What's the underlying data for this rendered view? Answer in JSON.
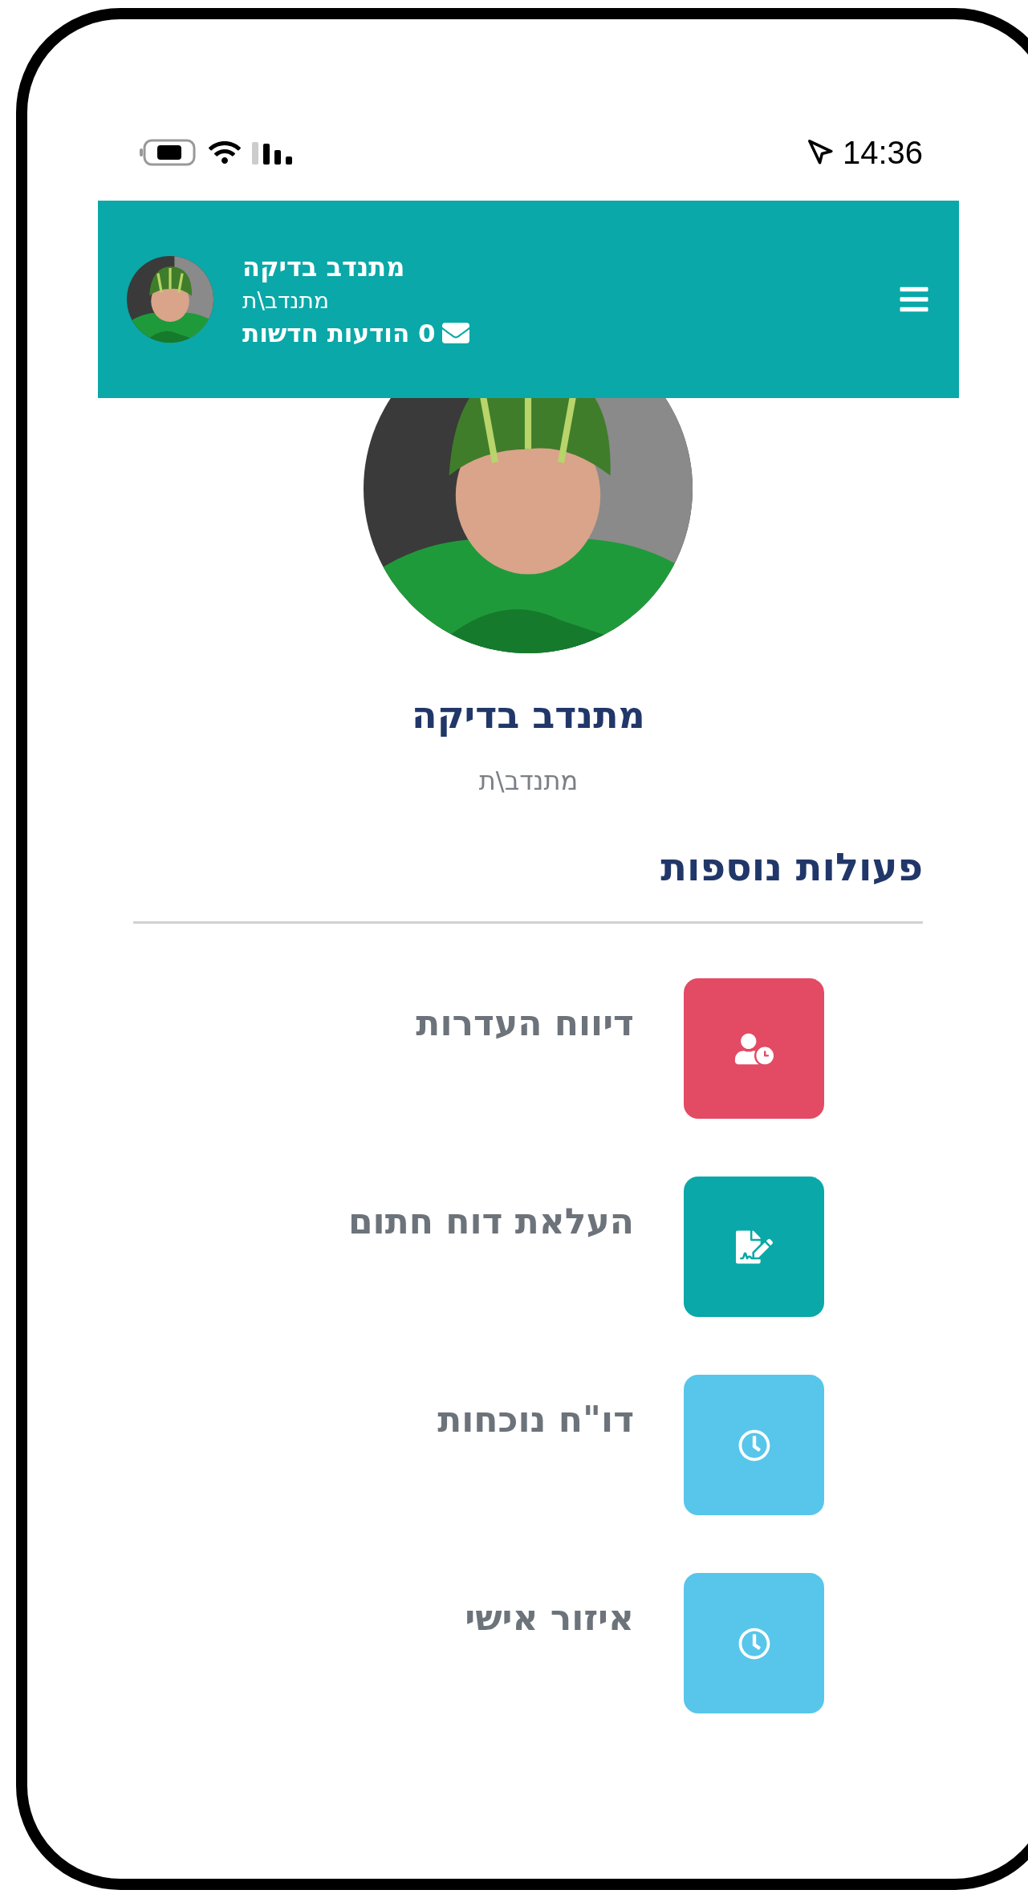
{
  "status_bar": {
    "time": "14:36"
  },
  "header": {
    "user_name": "מתנדב בדיקה",
    "role": "מתנדב\\ת",
    "messages": "0 הודעות חדשות"
  },
  "profile": {
    "name": "מתנדב בדיקה",
    "role": "מתנדב\\ת"
  },
  "section_title": "פעולות נוספות",
  "actions": [
    {
      "label": "דיווח העדרות",
      "kind": "absence",
      "color": "#e24b63"
    },
    {
      "label": "העלאת דוח חתום",
      "kind": "signed-report",
      "color": "#0aa8a8"
    },
    {
      "label": "דו\"ח נוכחות",
      "kind": "clock",
      "color": "#57c6ea"
    },
    {
      "label": "איזור אישי",
      "kind": "clock",
      "color": "#57c6ea"
    }
  ]
}
